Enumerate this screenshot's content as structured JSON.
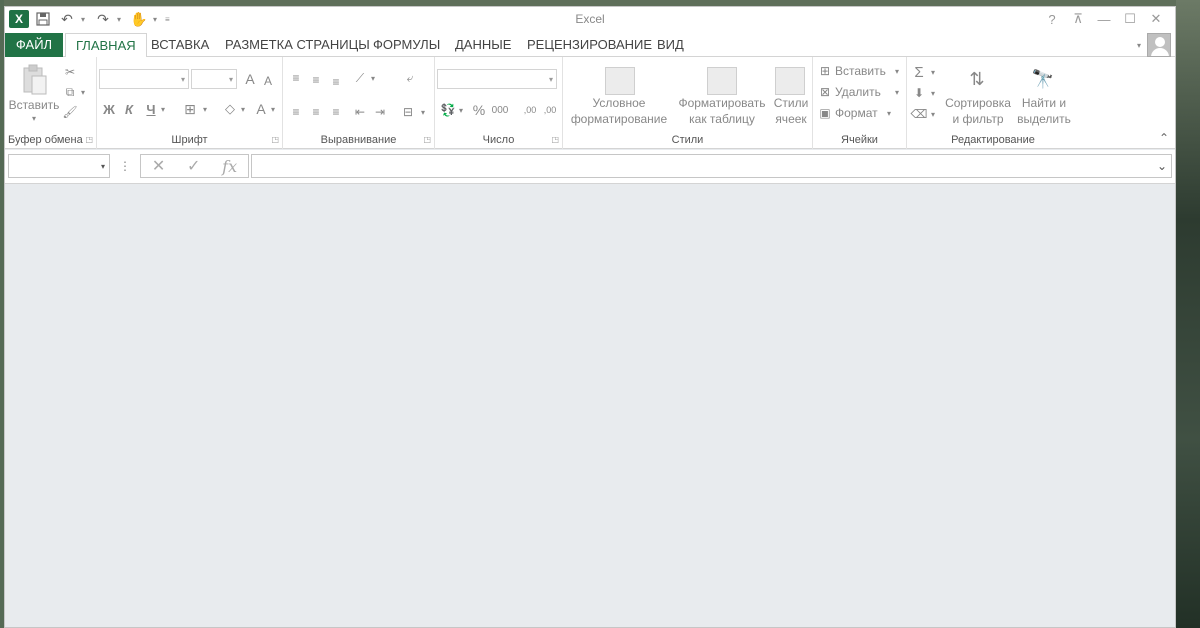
{
  "app": {
    "title": "Excel"
  },
  "qat": {
    "logo": "X",
    "save_icon": "save-icon",
    "undo_icon": "undo-icon",
    "redo_icon": "redo-icon",
    "touch_icon": "touch-mode-icon"
  },
  "window_controls": {
    "help": "?",
    "ribbon_display": "⊼",
    "minimize": "—",
    "maximize": "☐",
    "close": "✕"
  },
  "tabs": {
    "file": "ФАЙЛ",
    "items": [
      "ГЛАВНАЯ",
      "ВСТАВКА",
      "РАЗМЕТКА СТРАНИЦЫ",
      "ФОРМУЛЫ",
      "ДАННЫЕ",
      "РЕЦЕНЗИРОВАНИЕ",
      "ВИД"
    ]
  },
  "ribbon": {
    "clipboard": {
      "label": "Буфер обмена",
      "paste": "Вставить"
    },
    "font": {
      "label": "Шрифт",
      "bold": "Ж",
      "italic": "К",
      "underline": "Ч",
      "grow": "A",
      "shrink": "A",
      "color": "A"
    },
    "alignment": {
      "label": "Выравнивание"
    },
    "number": {
      "label": "Число",
      "percent": "%",
      "thousands": "000",
      "inc_dec": ",00",
      "dec_dec": ",00"
    },
    "styles": {
      "label": "Стили",
      "conditional_line1": "Условное",
      "conditional_line2": "форматирование",
      "format_table_line1": "Форматировать",
      "format_table_line2": "как таблицу",
      "cell_styles_line1": "Стили",
      "cell_styles_line2": "ячеек"
    },
    "cells": {
      "label": "Ячейки",
      "insert": "Вставить",
      "delete": "Удалить",
      "format": "Формат"
    },
    "editing": {
      "label": "Редактирование",
      "sort_line1": "Сортировка",
      "sort_line2": "и фильтр",
      "find_line1": "Найти и",
      "find_line2": "выделить",
      "sum": "Σ"
    }
  },
  "formula_bar": {
    "cancel": "✕",
    "enter": "✓",
    "fx": "fx",
    "value": ""
  }
}
